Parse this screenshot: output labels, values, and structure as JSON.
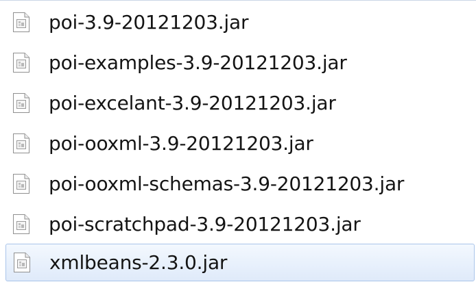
{
  "file_list": {
    "items": [
      {
        "name": "poi-3.9-20121203.jar",
        "icon": "jar-file-icon",
        "selected": false
      },
      {
        "name": "poi-examples-3.9-20121203.jar",
        "icon": "jar-file-icon",
        "selected": false
      },
      {
        "name": "poi-excelant-3.9-20121203.jar",
        "icon": "jar-file-icon",
        "selected": false
      },
      {
        "name": "poi-ooxml-3.9-20121203.jar",
        "icon": "jar-file-icon",
        "selected": false
      },
      {
        "name": "poi-ooxml-schemas-3.9-20121203.jar",
        "icon": "jar-file-icon",
        "selected": false
      },
      {
        "name": "poi-scratchpad-3.9-20121203.jar",
        "icon": "jar-file-icon",
        "selected": false
      },
      {
        "name": "xmlbeans-2.3.0.jar",
        "icon": "jar-file-icon",
        "selected": true
      }
    ]
  },
  "colors": {
    "selection_background": "#dfeafa",
    "selection_border": "#a9c4ea",
    "text": "#141414"
  }
}
